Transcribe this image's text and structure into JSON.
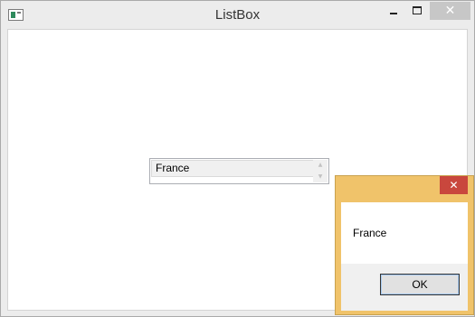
{
  "window": {
    "title": "ListBox",
    "icons": {
      "app": "window-app-icon",
      "minimize": "minimize-icon",
      "maximize": "maximize-icon",
      "close": "close-icon"
    },
    "close_glyph": "✕"
  },
  "listbox": {
    "items": [
      {
        "label": "France",
        "selected": true
      }
    ],
    "scroll_up_glyph": "▲",
    "scroll_down_glyph": "▼"
  },
  "message_box": {
    "message": "France",
    "ok_label": "OK",
    "close_glyph": "✕",
    "frame_color": "#f0c36a",
    "close_color": "#c9473d"
  }
}
